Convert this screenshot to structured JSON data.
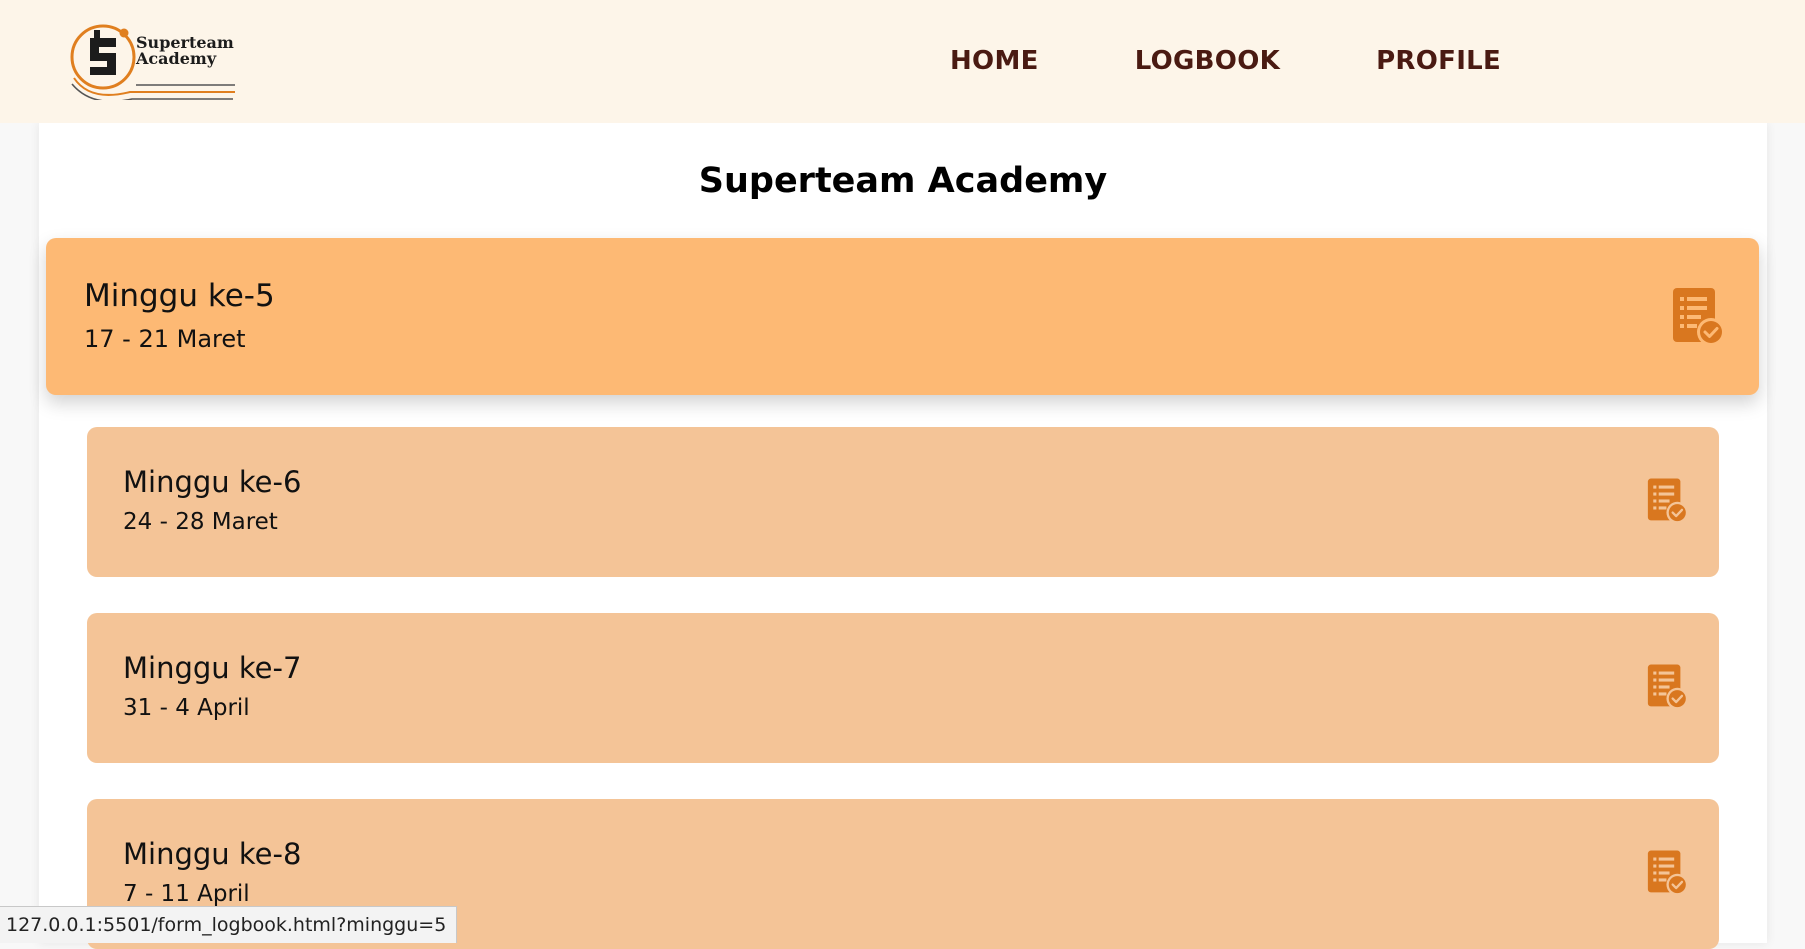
{
  "brand": {
    "logo_line1": "Superteam",
    "logo_line2": "Academy"
  },
  "nav": {
    "items": [
      {
        "label": "HOME"
      },
      {
        "label": "LOGBOOK"
      },
      {
        "label": "PROFILE"
      }
    ]
  },
  "page": {
    "title": "Superteam Academy"
  },
  "weeks": [
    {
      "title": "Minggu ke-5",
      "range": "17 - 21 Maret",
      "icon": "logbook-check-icon",
      "active": true
    },
    {
      "title": "Minggu ke-6",
      "range": "24 - 28 Maret",
      "icon": "logbook-check-icon",
      "active": false
    },
    {
      "title": "Minggu ke-7",
      "range": "31 - 4 April",
      "icon": "logbook-check-icon",
      "active": false
    },
    {
      "title": "Minggu ke-8",
      "range": "7 - 11 April",
      "icon": "logbook-check-icon",
      "active": false
    }
  ],
  "status_bar": {
    "url": "127.0.0.1:5501/form_logbook.html?minggu=5"
  },
  "colors": {
    "nav_bg": "#fdf5e9",
    "nav_text": "#4a1a12",
    "card_active": "#fdb974",
    "card": "#f4c497",
    "icon": "#d9771f"
  }
}
